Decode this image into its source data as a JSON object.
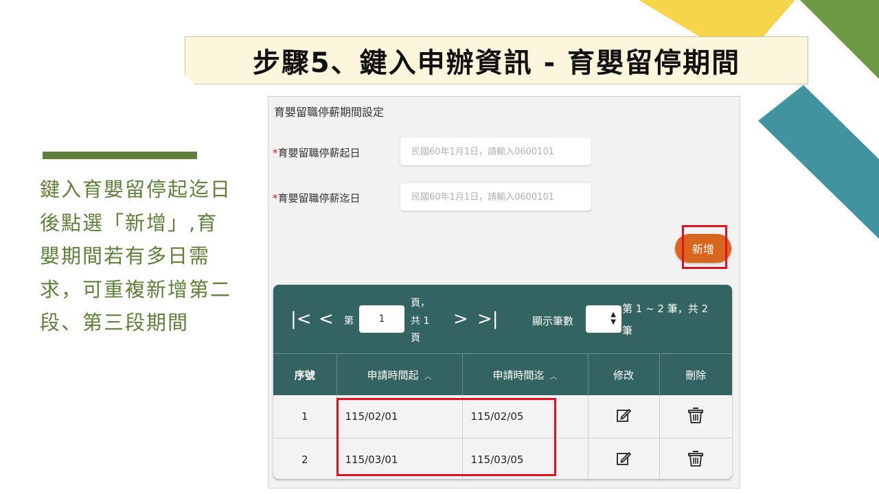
{
  "slide": {
    "title": "步驟5、鍵入申辦資訊 - 育嬰留停期間",
    "instruction": "鍵入育嬰留停起迄日後點選「新增」,育嬰期間若有多日需求，可重複新增第二段、第三段期間"
  },
  "form": {
    "section_title": "育嬰留職停薪期間設定",
    "required_mark": "*",
    "start_label": "育嬰留職停薪起日",
    "start_placeholder": "民國60年1月1日，請輸入0600101",
    "end_label": "育嬰留職停薪迄日",
    "end_placeholder": "民國60年1月1日，請輸入0600101",
    "add_button": "新增"
  },
  "pager": {
    "first_icon": "first-page-icon",
    "prev_icon": "prev-page-icon",
    "next_icon": "next-page-icon",
    "last_icon": "last-page-icon",
    "page_prefix": "第",
    "current_page": "1",
    "page_suffix_1": "頁，",
    "page_suffix_2": "共 1",
    "page_suffix_3": "頁",
    "page_size_label": "顯示筆數",
    "record_info_1": "第 1 ~ 2 筆，共 2",
    "record_info_2": "筆"
  },
  "table": {
    "columns": [
      "序號",
      "申請時間起",
      "申請時間迄",
      "修改",
      "刪除"
    ],
    "rows": [
      {
        "no": "1",
        "start": "115/02/01",
        "end": "115/02/05"
      },
      {
        "no": "2",
        "start": "115/03/01",
        "end": "115/03/05"
      }
    ]
  },
  "colors": {
    "header_teal": "#346461",
    "add_orange": "#d9661e",
    "highlight_red": "#e0121f",
    "text_green": "#5f7f3a",
    "deco_yellow": "#f7d54a",
    "deco_green": "#6f9a45",
    "deco_teal": "#40939f"
  }
}
